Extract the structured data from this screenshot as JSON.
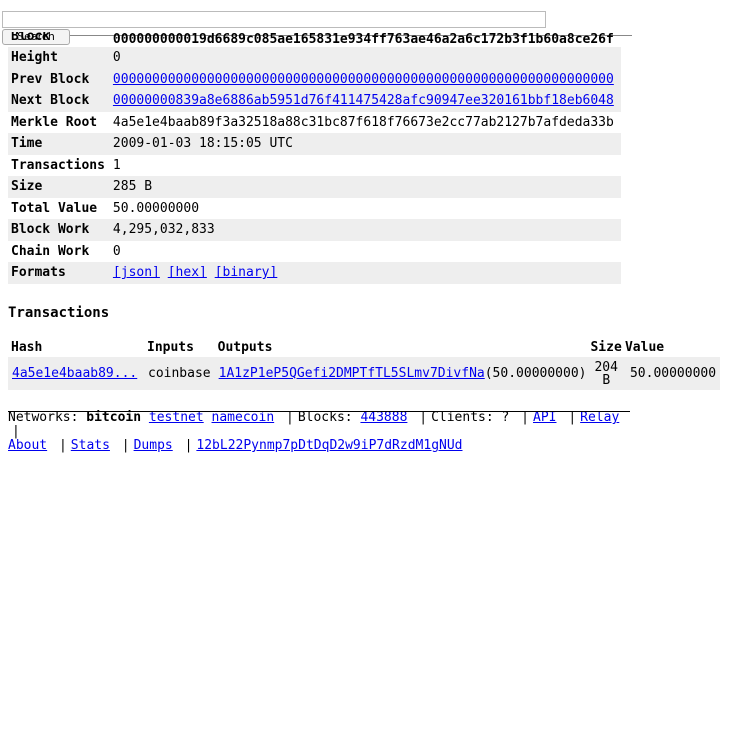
{
  "search": {
    "button_label": "Search",
    "placeholder": ""
  },
  "block": {
    "header_key": "Block",
    "header_value": "000000000019d6689c085ae165831e934ff763ae46a2a6c172b3f1b60a8ce26f",
    "rows": [
      {
        "key": "Height",
        "value": "0",
        "link": false
      },
      {
        "key": "Prev Block",
        "value": "0000000000000000000000000000000000000000000000000000000000000000",
        "link": true
      },
      {
        "key": "Next Block",
        "value": "00000000839a8e6886ab5951d76f411475428afc90947ee320161bbf18eb6048",
        "link": true
      },
      {
        "key": "Merkle Root",
        "value": "4a5e1e4baab89f3a32518a88c31bc87f618f76673e2cc77ab2127b7afdeda33b",
        "link": false
      },
      {
        "key": "Time",
        "value": "2009-01-03 18:15:05 UTC",
        "link": false
      },
      {
        "key": "Transactions",
        "value": "1",
        "link": false
      },
      {
        "key": "Size",
        "value": "285 B",
        "link": false
      },
      {
        "key": "Total Value",
        "value": "50.00000000",
        "link": false
      },
      {
        "key": "Block Work",
        "value": "4,295,032,833",
        "link": false
      },
      {
        "key": "Chain Work",
        "value": "0",
        "link": false
      }
    ],
    "formats_key": "Formats",
    "formats": [
      "[json]",
      "[hex]",
      "[binary]"
    ]
  },
  "transactions": {
    "title": "Transactions",
    "headers": {
      "hash": "Hash",
      "inputs": "Inputs",
      "outputs": "Outputs",
      "size": "Size",
      "value": "Value"
    },
    "rows": [
      {
        "hash": "4a5e1e4baab89...",
        "inputs": "coinbase",
        "output_address": "1A1zP1eP5QGefi2DMPTfTL5SLmv7DivfNa",
        "output_amount": "(50.00000000)",
        "size_num": "204",
        "size_unit": "B",
        "value": "50.00000000"
      }
    ]
  },
  "footer": {
    "networks_label": "Networks:",
    "current_network": "bitcoin",
    "networks": [
      "testnet",
      "namecoin"
    ],
    "blocks_label": "Blocks:",
    "blocks_value": "443888",
    "clients_label": "Clients: ?",
    "links_line1": [
      "API",
      "Relay"
    ],
    "links_line2": [
      "About",
      "Stats",
      "Dumps",
      "12bL22Pynmp7pDtDqD2w9iP7dRzdM1gNUd"
    ]
  }
}
